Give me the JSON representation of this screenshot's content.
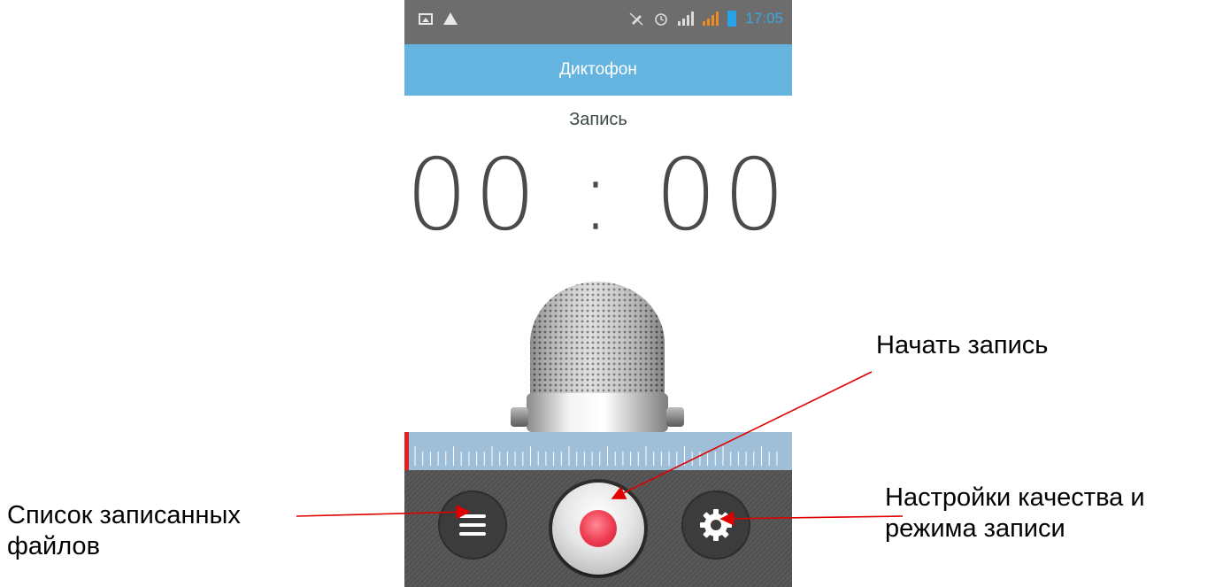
{
  "status_bar": {
    "time": "17:05",
    "icons_left": [
      "image-icon",
      "warning-icon"
    ],
    "icons_right": [
      "mute-icon",
      "alarm-icon",
      "signal-icon",
      "signal-orange-icon",
      "battery-icon"
    ]
  },
  "app_bar": {
    "title": "Диктофон"
  },
  "recorder": {
    "status_label": "Запись",
    "timer": "00 : 00"
  },
  "controls": {
    "list_icon": "menu-icon",
    "record_icon": "record-icon",
    "settings_icon": "gear-icon"
  },
  "annotations": {
    "start_recording": "Начать запись",
    "files_list_line1": "Список записанных",
    "files_list_line2": "файлов",
    "settings_line1": "Настройки качества и",
    "settings_line2": "режима записи"
  },
  "colors": {
    "app_bar": "#64b4df",
    "status_bar": "#6d6d6d",
    "ruler": "#9fbfd8",
    "record_dot": "#ee3b50",
    "arrow": "#e00000"
  }
}
